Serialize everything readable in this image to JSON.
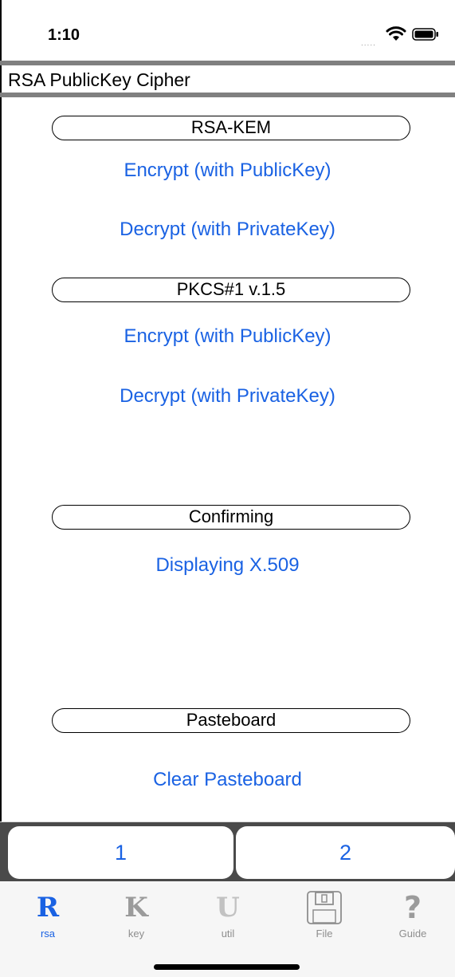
{
  "status_bar": {
    "time": "1:10",
    "signal": "....."
  },
  "title_bar": {
    "title": "RSA PublicKey Cipher"
  },
  "sections": [
    {
      "header": "RSA-KEM",
      "actions": [
        "Encrypt (with PublicKey)",
        "Decrypt (with PrivateKey)"
      ]
    },
    {
      "header": "PKCS#1 v.1.5",
      "actions": [
        "Encrypt (with PublicKey)",
        "Decrypt (with PrivateKey)"
      ]
    },
    {
      "header": "Confirming",
      "actions": [
        "Displaying X.509"
      ]
    },
    {
      "header": "Pasteboard",
      "actions": [
        "Clear Pasteboard"
      ]
    }
  ],
  "segments": [
    "1",
    "2"
  ],
  "tab_bar": {
    "active": "rsa",
    "tabs": [
      {
        "icon": "R",
        "label": "rsa"
      },
      {
        "icon": "K",
        "label": "key"
      },
      {
        "icon": "U",
        "label": "util"
      },
      {
        "icon": "floppy-disk-icon",
        "label": "File"
      },
      {
        "icon": "?",
        "label": "Guide"
      }
    ]
  },
  "colors": {
    "accent": "#1a62e3",
    "separator": "#808080",
    "segment_bg": "#4a4a4a"
  }
}
